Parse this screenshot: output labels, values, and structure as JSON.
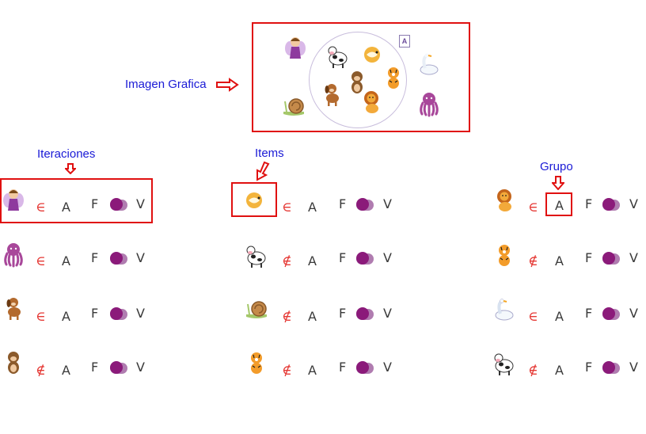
{
  "annotations": {
    "image_label": "Imagen Grafica",
    "iterations_label": "Iteraciones",
    "items_label": "Items",
    "group_label": "Grupo"
  },
  "graphic": {
    "set_label": "A",
    "outside_items": [
      "fairy",
      "snail",
      "swan",
      "octopus"
    ],
    "inside_items": [
      "cow",
      "hamster",
      "monkey",
      "tiger",
      "dog",
      "lion"
    ]
  },
  "rows": [
    {
      "iteration": "fairy",
      "item": "hamster",
      "group_icon": "lion",
      "relation_left": "∈",
      "relation_mid": "∈",
      "relation_right": "∈"
    },
    {
      "iteration": "octopus",
      "item": "cow",
      "group_icon": "tiger",
      "relation_left": "∈",
      "relation_mid": "∉",
      "relation_right": "∉"
    },
    {
      "iteration": "dog",
      "item": "snail",
      "group_icon": "swan",
      "relation_left": "∈",
      "relation_mid": "∉",
      "relation_right": "∈"
    },
    {
      "iteration": "monkey",
      "item": "tiger",
      "group_icon": "cow",
      "relation_left": "∉",
      "relation_mid": "∉",
      "relation_right": "∉"
    }
  ],
  "symbols": {
    "set": "A",
    "false": "F",
    "true": "V"
  },
  "colors": {
    "annotation": "#1a1ad6",
    "highlight_box": "#e01010",
    "epsilon": "#e53935",
    "toggle_track": "#b07cb0",
    "toggle_knob": "#8b1a7a"
  }
}
